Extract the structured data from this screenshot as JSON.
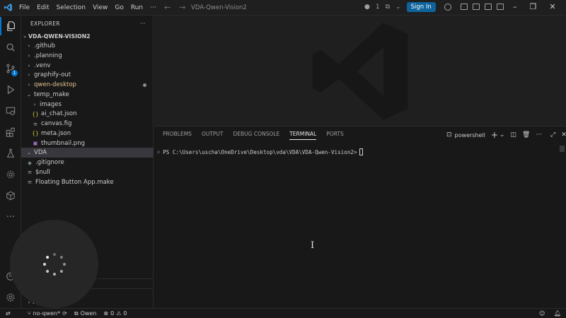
{
  "titlebar": {
    "menu": [
      "File",
      "Edit",
      "Selection",
      "View",
      "Go",
      "Run",
      "···"
    ],
    "search_text": "VDA-Qwen-Vision2",
    "notification_count": "1",
    "signin_label": "Sign In"
  },
  "activity_bar": {
    "source_control_badge": "1"
  },
  "sidebar": {
    "header": "EXPLORER",
    "more": "···",
    "root_label": "VDA-QWEN-VISION2",
    "tree": [
      {
        "label": ".github",
        "kind": "folder",
        "expanded": false,
        "indent": 1
      },
      {
        "label": ".planning",
        "kind": "folder",
        "expanded": false,
        "indent": 1
      },
      {
        "label": ".venv",
        "kind": "folder",
        "expanded": false,
        "indent": 1
      },
      {
        "label": "graphify-out",
        "kind": "folder",
        "expanded": false,
        "indent": 1
      },
      {
        "label": "qwen-desktop",
        "kind": "folder",
        "expanded": false,
        "indent": 1,
        "modified": true
      },
      {
        "label": "temp_make",
        "kind": "folder",
        "expanded": true,
        "indent": 1
      },
      {
        "label": "images",
        "kind": "folder",
        "expanded": false,
        "indent": 2
      },
      {
        "label": "ai_chat.json",
        "kind": "json",
        "indent": 2
      },
      {
        "label": "canvas.fig",
        "kind": "file",
        "indent": 2
      },
      {
        "label": "meta.json",
        "kind": "json",
        "indent": 2
      },
      {
        "label": "thumbnail.png",
        "kind": "image",
        "indent": 2
      },
      {
        "label": "VDA",
        "kind": "folder",
        "expanded": true,
        "indent": 1,
        "selected": true
      },
      {
        "label": ".gitignore",
        "kind": "git",
        "indent": 1
      },
      {
        "label": "$null",
        "kind": "file",
        "indent": 1
      },
      {
        "label": "Floating Button App.make",
        "kind": "file",
        "indent": 1
      }
    ],
    "bottom_section": "N"
  },
  "panel": {
    "tabs": [
      "PROBLEMS",
      "OUTPUT",
      "DEBUG CONSOLE",
      "TERMINAL",
      "PORTS"
    ],
    "active_tab": "TERMINAL",
    "shell_label": "powershell",
    "terminal_line": "PS C:\\Users\\uscha\\OneDrive\\Desktop\\vda\\VDA\\VDA-Qwen-Vision2>"
  },
  "statusbar": {
    "branch": "no-qwen*",
    "account": "Owen",
    "errors": "0",
    "warnings": "0"
  },
  "colors": {
    "accent": "#0078d4",
    "signin": "#0e639c",
    "folder_modified": "#e2c08d"
  }
}
